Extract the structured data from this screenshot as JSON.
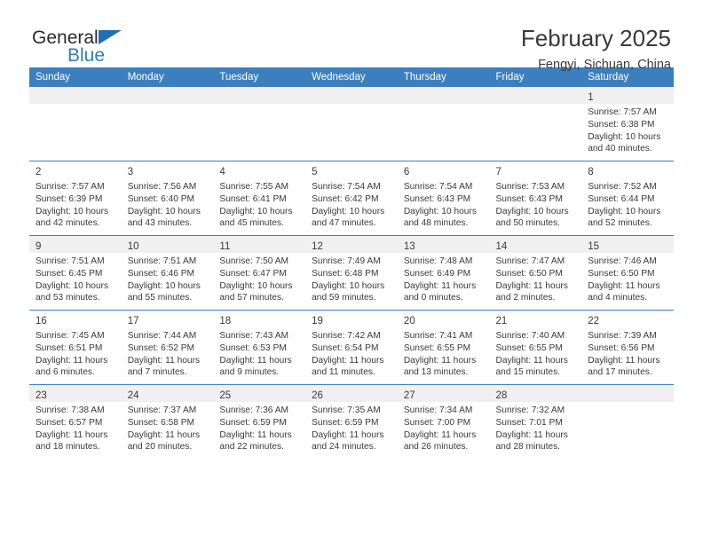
{
  "brand": {
    "name_top": "General",
    "name_bottom": "Blue",
    "triangle_color": "#1f6fb4",
    "blue_text_color": "#2e7dc1"
  },
  "header": {
    "month_title": "February 2025",
    "location": "Fengyi, Sichuan, China"
  },
  "theme": {
    "header_blue": "#3c7fbf",
    "row_shade": "#f0f0f0",
    "text": "#3a3a3a"
  },
  "calendar": {
    "weekday_headers": [
      "Sunday",
      "Monday",
      "Tuesday",
      "Wednesday",
      "Thursday",
      "Friday",
      "Saturday"
    ],
    "weeks": [
      [
        {
          "empty": true
        },
        {
          "empty": true
        },
        {
          "empty": true
        },
        {
          "empty": true
        },
        {
          "empty": true
        },
        {
          "empty": true
        },
        {
          "day": "1",
          "sunrise": "Sunrise: 7:57 AM",
          "sunset": "Sunset: 6:38 PM",
          "daylight_1": "Daylight: 10 hours",
          "daylight_2": "and 40 minutes."
        }
      ],
      [
        {
          "day": "2",
          "sunrise": "Sunrise: 7:57 AM",
          "sunset": "Sunset: 6:39 PM",
          "daylight_1": "Daylight: 10 hours",
          "daylight_2": "and 42 minutes."
        },
        {
          "day": "3",
          "sunrise": "Sunrise: 7:56 AM",
          "sunset": "Sunset: 6:40 PM",
          "daylight_1": "Daylight: 10 hours",
          "daylight_2": "and 43 minutes."
        },
        {
          "day": "4",
          "sunrise": "Sunrise: 7:55 AM",
          "sunset": "Sunset: 6:41 PM",
          "daylight_1": "Daylight: 10 hours",
          "daylight_2": "and 45 minutes."
        },
        {
          "day": "5",
          "sunrise": "Sunrise: 7:54 AM",
          "sunset": "Sunset: 6:42 PM",
          "daylight_1": "Daylight: 10 hours",
          "daylight_2": "and 47 minutes."
        },
        {
          "day": "6",
          "sunrise": "Sunrise: 7:54 AM",
          "sunset": "Sunset: 6:43 PM",
          "daylight_1": "Daylight: 10 hours",
          "daylight_2": "and 48 minutes."
        },
        {
          "day": "7",
          "sunrise": "Sunrise: 7:53 AM",
          "sunset": "Sunset: 6:43 PM",
          "daylight_1": "Daylight: 10 hours",
          "daylight_2": "and 50 minutes."
        },
        {
          "day": "8",
          "sunrise": "Sunrise: 7:52 AM",
          "sunset": "Sunset: 6:44 PM",
          "daylight_1": "Daylight: 10 hours",
          "daylight_2": "and 52 minutes."
        }
      ],
      [
        {
          "day": "9",
          "sunrise": "Sunrise: 7:51 AM",
          "sunset": "Sunset: 6:45 PM",
          "daylight_1": "Daylight: 10 hours",
          "daylight_2": "and 53 minutes."
        },
        {
          "day": "10",
          "sunrise": "Sunrise: 7:51 AM",
          "sunset": "Sunset: 6:46 PM",
          "daylight_1": "Daylight: 10 hours",
          "daylight_2": "and 55 minutes."
        },
        {
          "day": "11",
          "sunrise": "Sunrise: 7:50 AM",
          "sunset": "Sunset: 6:47 PM",
          "daylight_1": "Daylight: 10 hours",
          "daylight_2": "and 57 minutes."
        },
        {
          "day": "12",
          "sunrise": "Sunrise: 7:49 AM",
          "sunset": "Sunset: 6:48 PM",
          "daylight_1": "Daylight: 10 hours",
          "daylight_2": "and 59 minutes."
        },
        {
          "day": "13",
          "sunrise": "Sunrise: 7:48 AM",
          "sunset": "Sunset: 6:49 PM",
          "daylight_1": "Daylight: 11 hours",
          "daylight_2": "and 0 minutes."
        },
        {
          "day": "14",
          "sunrise": "Sunrise: 7:47 AM",
          "sunset": "Sunset: 6:50 PM",
          "daylight_1": "Daylight: 11 hours",
          "daylight_2": "and 2 minutes."
        },
        {
          "day": "15",
          "sunrise": "Sunrise: 7:46 AM",
          "sunset": "Sunset: 6:50 PM",
          "daylight_1": "Daylight: 11 hours",
          "daylight_2": "and 4 minutes."
        }
      ],
      [
        {
          "day": "16",
          "sunrise": "Sunrise: 7:45 AM",
          "sunset": "Sunset: 6:51 PM",
          "daylight_1": "Daylight: 11 hours",
          "daylight_2": "and 6 minutes."
        },
        {
          "day": "17",
          "sunrise": "Sunrise: 7:44 AM",
          "sunset": "Sunset: 6:52 PM",
          "daylight_1": "Daylight: 11 hours",
          "daylight_2": "and 7 minutes."
        },
        {
          "day": "18",
          "sunrise": "Sunrise: 7:43 AM",
          "sunset": "Sunset: 6:53 PM",
          "daylight_1": "Daylight: 11 hours",
          "daylight_2": "and 9 minutes."
        },
        {
          "day": "19",
          "sunrise": "Sunrise: 7:42 AM",
          "sunset": "Sunset: 6:54 PM",
          "daylight_1": "Daylight: 11 hours",
          "daylight_2": "and 11 minutes."
        },
        {
          "day": "20",
          "sunrise": "Sunrise: 7:41 AM",
          "sunset": "Sunset: 6:55 PM",
          "daylight_1": "Daylight: 11 hours",
          "daylight_2": "and 13 minutes."
        },
        {
          "day": "21",
          "sunrise": "Sunrise: 7:40 AM",
          "sunset": "Sunset: 6:55 PM",
          "daylight_1": "Daylight: 11 hours",
          "daylight_2": "and 15 minutes."
        },
        {
          "day": "22",
          "sunrise": "Sunrise: 7:39 AM",
          "sunset": "Sunset: 6:56 PM",
          "daylight_1": "Daylight: 11 hours",
          "daylight_2": "and 17 minutes."
        }
      ],
      [
        {
          "day": "23",
          "sunrise": "Sunrise: 7:38 AM",
          "sunset": "Sunset: 6:57 PM",
          "daylight_1": "Daylight: 11 hours",
          "daylight_2": "and 18 minutes."
        },
        {
          "day": "24",
          "sunrise": "Sunrise: 7:37 AM",
          "sunset": "Sunset: 6:58 PM",
          "daylight_1": "Daylight: 11 hours",
          "daylight_2": "and 20 minutes."
        },
        {
          "day": "25",
          "sunrise": "Sunrise: 7:36 AM",
          "sunset": "Sunset: 6:59 PM",
          "daylight_1": "Daylight: 11 hours",
          "daylight_2": "and 22 minutes."
        },
        {
          "day": "26",
          "sunrise": "Sunrise: 7:35 AM",
          "sunset": "Sunset: 6:59 PM",
          "daylight_1": "Daylight: 11 hours",
          "daylight_2": "and 24 minutes."
        },
        {
          "day": "27",
          "sunrise": "Sunrise: 7:34 AM",
          "sunset": "Sunset: 7:00 PM",
          "daylight_1": "Daylight: 11 hours",
          "daylight_2": "and 26 minutes."
        },
        {
          "day": "28",
          "sunrise": "Sunrise: 7:32 AM",
          "sunset": "Sunset: 7:01 PM",
          "daylight_1": "Daylight: 11 hours",
          "daylight_2": "and 28 minutes."
        },
        {
          "empty": true
        }
      ]
    ]
  }
}
